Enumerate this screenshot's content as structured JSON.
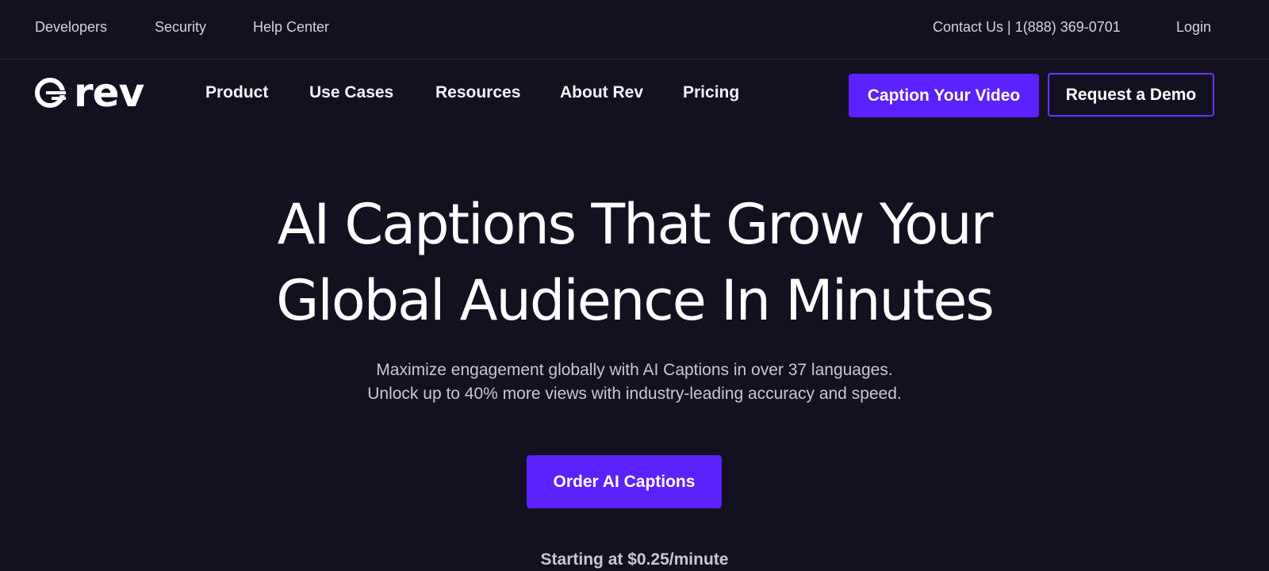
{
  "topbar": {
    "developers": "Developers",
    "security": "Security",
    "help_center": "Help Center",
    "contact": "Contact Us | 1(888) 369-0701",
    "login": "Login"
  },
  "nav": {
    "logo_text": "rev",
    "items": [
      "Product",
      "Use Cases",
      "Resources",
      "About Rev",
      "Pricing"
    ],
    "caption_button": "Caption Your Video",
    "demo_button": "Request a Demo"
  },
  "hero": {
    "title_line1": "AI Captions That Grow Your",
    "title_line2": "Global Audience In Minutes",
    "subtitle_line1": "Maximize engagement globally with AI Captions in over 37 languages.",
    "subtitle_line2": "Unlock up to 40% more views with industry-leading accuracy and speed.",
    "cta": "Order AI Captions",
    "price_note": "Starting at $0.25/minute"
  },
  "colors": {
    "background": "#131020",
    "accent": "#5b22ff",
    "outline": "#6a37ff"
  },
  "icons": {
    "logo": "rev-logo-icon"
  }
}
